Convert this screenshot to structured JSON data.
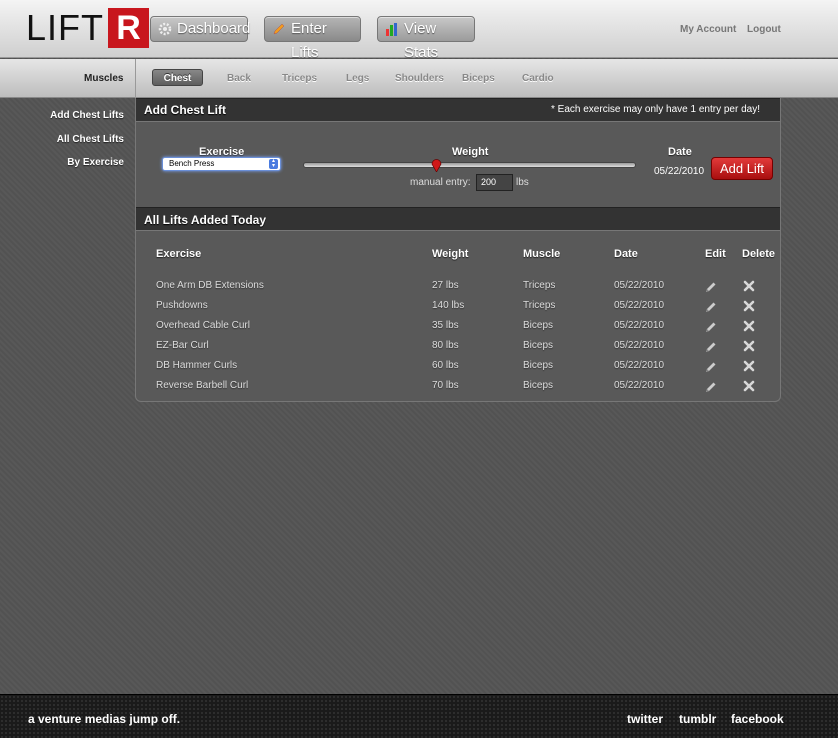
{
  "header": {
    "logo_text": "LIFT",
    "logo_box_letter": "R",
    "nav": [
      {
        "label": "Dashboard",
        "icon": "gear-icon"
      },
      {
        "label": "Enter Lifts",
        "icon": "pencil-icon"
      },
      {
        "label": "View Stats",
        "icon": "bar-chart-icon"
      }
    ],
    "my_account": "My Account",
    "logout": "Logout"
  },
  "subnav": {
    "label": "Muscles",
    "tabs": [
      "Chest",
      "Back",
      "Triceps",
      "Legs",
      "Shoulders",
      "Biceps",
      "Cardio"
    ],
    "active": "Chest"
  },
  "sidebar": {
    "items": [
      "Add Chest Lifts",
      "All Chest Lifts",
      "By Exercise"
    ]
  },
  "add_form": {
    "title": "Add Chest Lift",
    "note": "* Each exercise may only have 1 entry per day!",
    "exercise_label": "Exercise",
    "exercise_value": "Bench Press",
    "weight_label": "Weight",
    "manual_label": "manual entry:",
    "manual_value": "200",
    "unit": "lbs",
    "date_label": "Date",
    "date_value": "05/22/2010",
    "add_button": "Add Lift",
    "slider_fraction": 0.4
  },
  "table": {
    "title": "All Lifts Added Today",
    "headers": [
      "Exercise",
      "Weight",
      "Muscle",
      "Date",
      "Edit",
      "Delete"
    ],
    "rows": [
      [
        "One Arm DB Extensions",
        "27 lbs",
        "Triceps",
        "05/22/2010"
      ],
      [
        "Pushdowns",
        "140 lbs",
        "Triceps",
        "05/22/2010"
      ],
      [
        "Overhead Cable Curl",
        "35 lbs",
        "Biceps",
        "05/22/2010"
      ],
      [
        "EZ-Bar Curl",
        "80 lbs",
        "Biceps",
        "05/22/2010"
      ],
      [
        "DB Hammer Curls",
        "60 lbs",
        "Biceps",
        "05/22/2010"
      ],
      [
        "Reverse Barbell Curl",
        "70 lbs",
        "Biceps",
        "05/22/2010"
      ]
    ]
  },
  "footer": {
    "tagline": "a venture medias jump off.",
    "links": [
      "twitter",
      "tumblr",
      "facebook"
    ]
  },
  "colors": {
    "brand_red": "#c8161d",
    "background": "#545454",
    "panel_header": "#333333"
  }
}
